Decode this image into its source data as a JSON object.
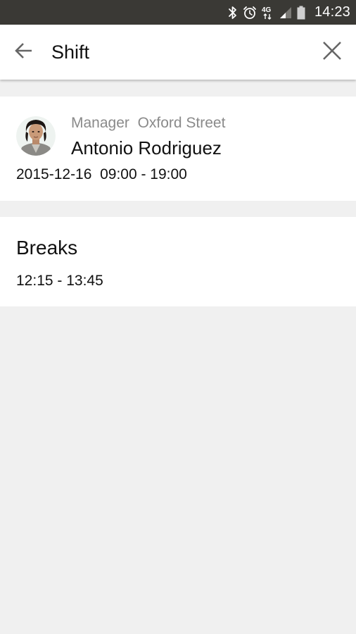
{
  "status_bar": {
    "time": "14:23",
    "icons": [
      "bluetooth-icon",
      "alarm-icon",
      "4g-icon",
      "signal-icon",
      "battery-icon"
    ],
    "network_label": "4G"
  },
  "app_bar": {
    "title": "Shift",
    "back_icon": "arrow-back-icon",
    "close_icon": "close-icon"
  },
  "shift": {
    "role": "Manager",
    "location": "Oxford Street",
    "employee_name": "Antonio Rodriguez",
    "date": "2015-12-16",
    "time_range": "09:00 - 19:00"
  },
  "breaks": {
    "title": "Breaks",
    "items": [
      {
        "time_range": "12:15 - 13:45"
      }
    ]
  },
  "colors": {
    "status_bar_bg": "#3a3935",
    "app_bar_bg": "#ffffff",
    "page_bg": "#f0f0f0",
    "primary_text": "#111111",
    "secondary_text": "#8a8a8a",
    "icon_gray": "#666666"
  }
}
